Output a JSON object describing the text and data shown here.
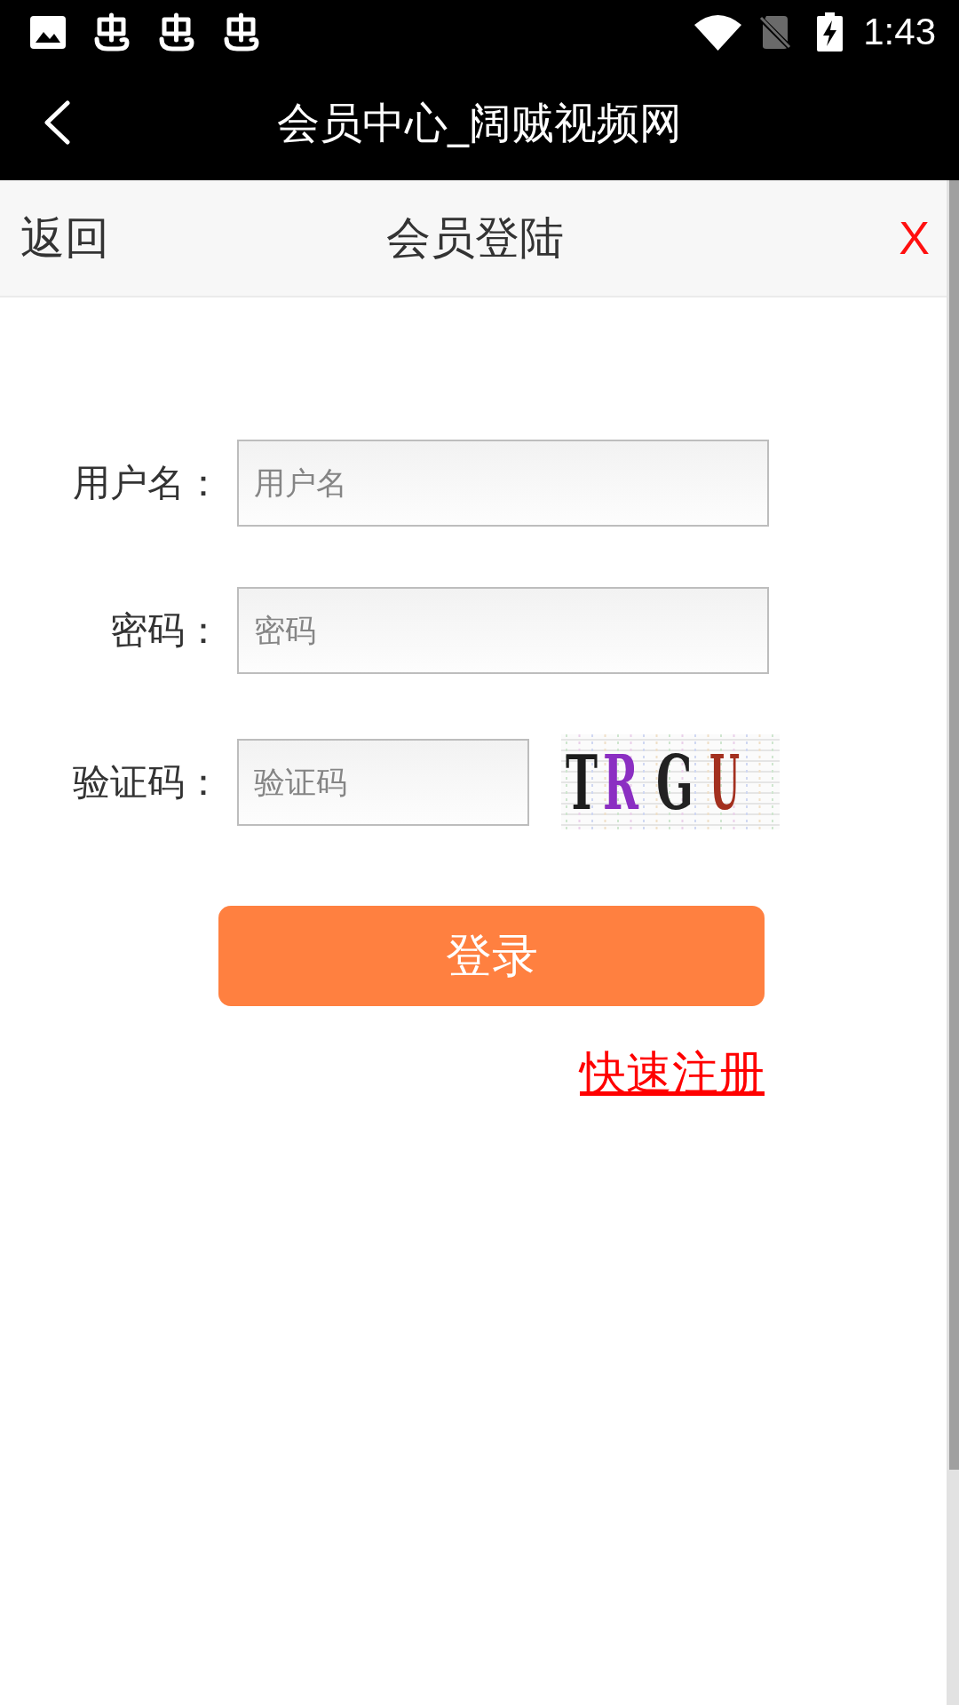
{
  "status_bar": {
    "time": "1:43"
  },
  "app_bar": {
    "title": "会员中心_阔贼视频网"
  },
  "dialog": {
    "back": "返回",
    "title": "会员登陆",
    "close": "X"
  },
  "form": {
    "fields": [
      {
        "kind": "text",
        "label": "用户名：",
        "placeholder": "用户名"
      },
      {
        "kind": "password",
        "label": "密码：",
        "placeholder": "密码"
      },
      {
        "kind": "captcha",
        "label": "验证码：",
        "placeholder": "验证码",
        "captcha": [
          {
            "text": "T",
            "color": "#1c1c1c"
          },
          {
            "text": "R",
            "color": "#8b2fc2"
          },
          {
            "text": "G",
            "color": "#222222"
          },
          {
            "text": "U",
            "color": "#a3301f"
          }
        ]
      }
    ],
    "submit": "登录",
    "register_link": "快速注册"
  }
}
